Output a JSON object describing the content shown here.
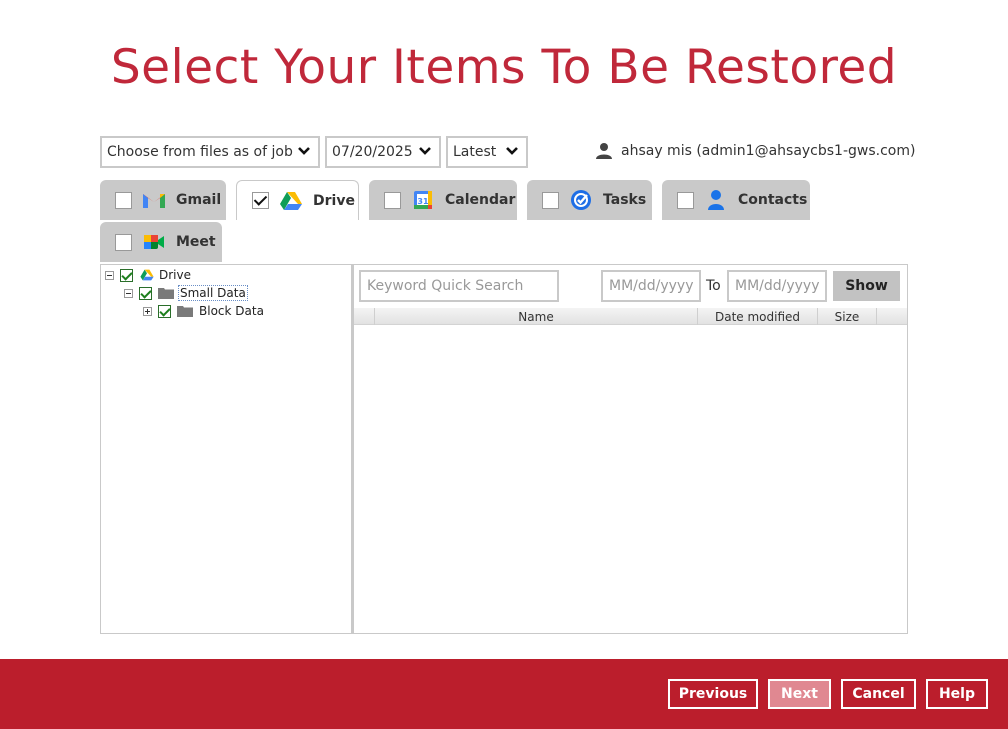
{
  "title": "Select Your Items To Be Restored",
  "filters": {
    "job_option": "Choose from files as of job",
    "date": "07/20/2025",
    "version": "Latest"
  },
  "user": {
    "name": "ahsay mis (admin1@ahsaycbs1-gws.com)"
  },
  "tabs": [
    {
      "label": "Gmail",
      "checked": false,
      "active": false
    },
    {
      "label": "Drive",
      "checked": true,
      "active": true
    },
    {
      "label": "Calendar",
      "checked": false,
      "active": false
    },
    {
      "label": "Tasks",
      "checked": false,
      "active": false
    },
    {
      "label": "Contacts",
      "checked": false,
      "active": false
    },
    {
      "label": "Meet",
      "checked": false,
      "active": false
    }
  ],
  "tree": [
    {
      "label": "Drive",
      "checked": true
    },
    {
      "label": "Small Data",
      "checked": true,
      "selected": true
    },
    {
      "label": "Block Data",
      "checked": true
    }
  ],
  "search": {
    "keyword_placeholder": "Keyword Quick Search",
    "from_placeholder": "MM/dd/yyyy",
    "to_label": "To",
    "to_placeholder": "MM/dd/yyyy",
    "show_label": "Show"
  },
  "table": {
    "columns": [
      "Name",
      "Date modified",
      "Size"
    ],
    "rows": []
  },
  "footer": {
    "previous": "Previous",
    "next": "Next",
    "cancel": "Cancel",
    "help": "Help"
  },
  "colors": {
    "brand": "#bb1e2c",
    "title": "#c0283a",
    "tab_inactive": "#c9c9c9"
  }
}
